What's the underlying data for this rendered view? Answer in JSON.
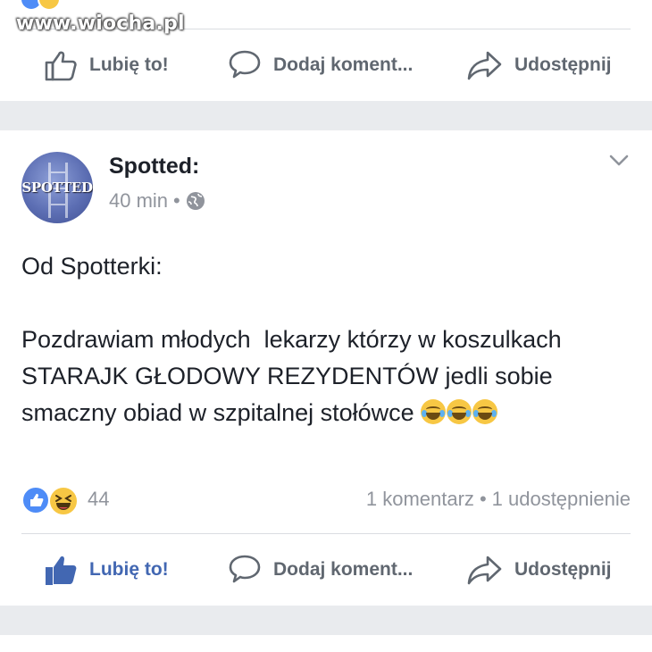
{
  "watermark": "www.wiocha.pl",
  "actions": {
    "like_label": "Lubię to!",
    "comment_label": "Dodaj koment...",
    "share_label": "Udostępnij"
  },
  "post": {
    "page_name": "Spotted:",
    "avatar_text": "SPOTTED",
    "timestamp": "40 min",
    "separator": "•",
    "body": {
      "line1": "Od Spotterki:",
      "line2": "Pozdrawiam młodych  lekarzy którzy w koszulkach STARAJK GŁODOWY REZYDENTÓW jedli sobie smaczny obiad w szpitalnej stołówce"
    },
    "reactions": {
      "count": "44",
      "icons": [
        "like-icon",
        "haha-icon"
      ]
    },
    "comments_count": "1 komentarz",
    "shares_count": "1 udostępnienie",
    "liked": true
  },
  "colors": {
    "facebook_blue": "#4267b2",
    "gray_text": "#606770",
    "meta_gray": "#90949c",
    "separator_band": "#e9ebee"
  }
}
